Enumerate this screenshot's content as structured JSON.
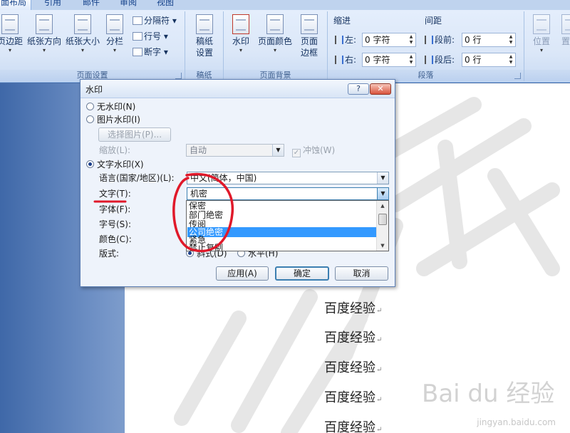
{
  "ribbon": {
    "tabs": [
      "面布局",
      "引用",
      "邮件",
      "审阅",
      "视图"
    ],
    "groups": {
      "page_setup": {
        "label": "页面设置",
        "margins": "页边距",
        "orientation": "纸张方向",
        "size": "纸张大小",
        "columns": "分栏",
        "breaks": "分隔符",
        "line_numbers": "行号",
        "hyphenation": "断字"
      },
      "draft": {
        "label": "稿纸",
        "draft_setup": [
          "稿纸",
          "设置"
        ]
      },
      "page_background": {
        "label": "页面背景",
        "watermark": "水印",
        "page_color": "页面颜色",
        "page_borders": [
          "页面",
          "边框"
        ]
      },
      "paragraph": {
        "label": "段落",
        "indent_title": "缩进",
        "spacing_title": "间距",
        "indent_left_label": "左:",
        "indent_left_value": "0 字符",
        "indent_right_label": "右:",
        "indent_right_value": "0 字符",
        "spacing_before_label": "段前:",
        "spacing_before_value": "0 行",
        "spacing_after_label": "段后:",
        "spacing_after_value": "0 行"
      },
      "arrange": {
        "position": "位置",
        "wrap": "置于"
      }
    }
  },
  "document": {
    "lines": [
      "百度经验",
      "百度经验",
      "百度经验",
      "百度经验",
      "百度经验"
    ],
    "paragraph_mark": "↵",
    "site_logo": "Bai du 经验",
    "site_url": "jingyan.baidu.com"
  },
  "dialog": {
    "title": "水印",
    "help_button": "?",
    "close_button": "✕",
    "no_watermark": "无水印(N)",
    "picture_watermark": "图片水印(I)",
    "select_picture": "选择图片(P)...",
    "scale_label": "缩放(L):",
    "scale_value": "自动",
    "washout_label": "冲蚀(W)",
    "washout_checked": true,
    "text_watermark": "文字水印(X)",
    "selected_option": "text_watermark",
    "language_label": "语言(国家/地区)(L):",
    "language_value": "中文(简体，中国)",
    "text_label": "文字(T):",
    "text_value": "机密",
    "font_label": "字体(F):",
    "size_label": "字号(S):",
    "color_label": "颜色(C):",
    "layout_label": "版式:",
    "layout_diagonal": "斜式(D)",
    "layout_horizontal": "水平(H)",
    "apply_button": "应用(A)",
    "ok_button": "确定",
    "cancel_button": "取消",
    "text_options": [
      "保密",
      "部门绝密",
      "传阅",
      "公司绝密",
      "紧急",
      "禁止复制"
    ],
    "selected_text_option": "公司绝密"
  },
  "colors": {
    "ribbon_top": "#e4eefc",
    "ribbon_bottom": "#c9dbf3",
    "group_label": "#3e5f8f",
    "dialog_bg": "#eef3fb",
    "selection": "#3399ff",
    "annotation_red": "#e0192a",
    "watermark_gray": "#e6e6e6"
  },
  "icons": {
    "margins": "margins-icon",
    "orientation": "orientation-icon",
    "size": "paper-size-icon",
    "columns": "columns-icon",
    "breaks": "breaks-icon",
    "line_numbers": "line-numbers-icon",
    "hyphenation": "hyphenation-icon",
    "draft": "draft-paper-icon",
    "watermark": "watermark-icon",
    "page_color": "page-color-icon",
    "page_borders": "page-borders-icon",
    "indent": "indent-icon",
    "spacing": "spacing-icon",
    "position": "position-icon",
    "wrap": "wrap-icon"
  }
}
